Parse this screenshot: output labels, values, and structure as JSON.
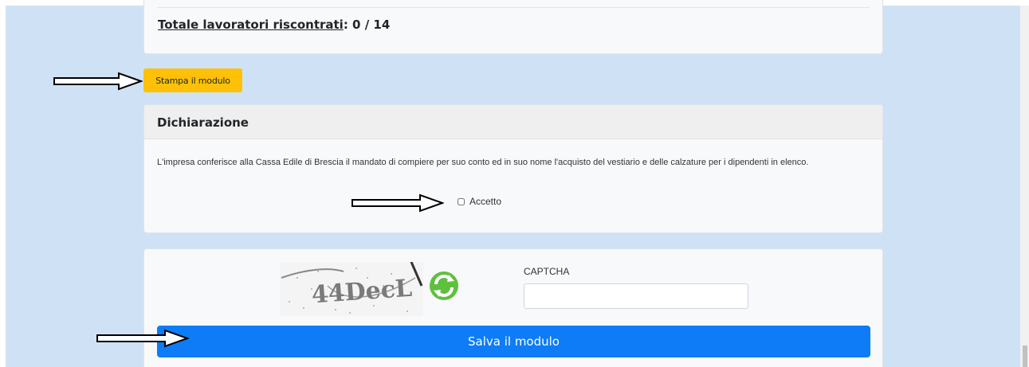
{
  "summary": {
    "totale_label": "Totale lavoratori riscontrati",
    "totale_value": ": 0 / 14"
  },
  "actions": {
    "stampa_label": "Stampa il modulo",
    "salva_label": "Salva il modulo"
  },
  "dichiarazione": {
    "title": "Dichiarazione",
    "text": "L'impresa conferisce alla Cassa Edile di Brescia il mandato di compiere per suo conto ed in suo nome l'acquisto del vestiario e delle calzature per i dipendenti in elenco.",
    "accetto_label": "Accetto",
    "accetto_checked": false
  },
  "captcha": {
    "label": "CAPTCHA",
    "image_text": "44DecL",
    "input_value": "",
    "refresh_icon": "refresh-icon"
  },
  "colors": {
    "page_background": "#cfe2f5",
    "stampa_button": "#ffc107",
    "salva_button": "#0d7cf6"
  }
}
